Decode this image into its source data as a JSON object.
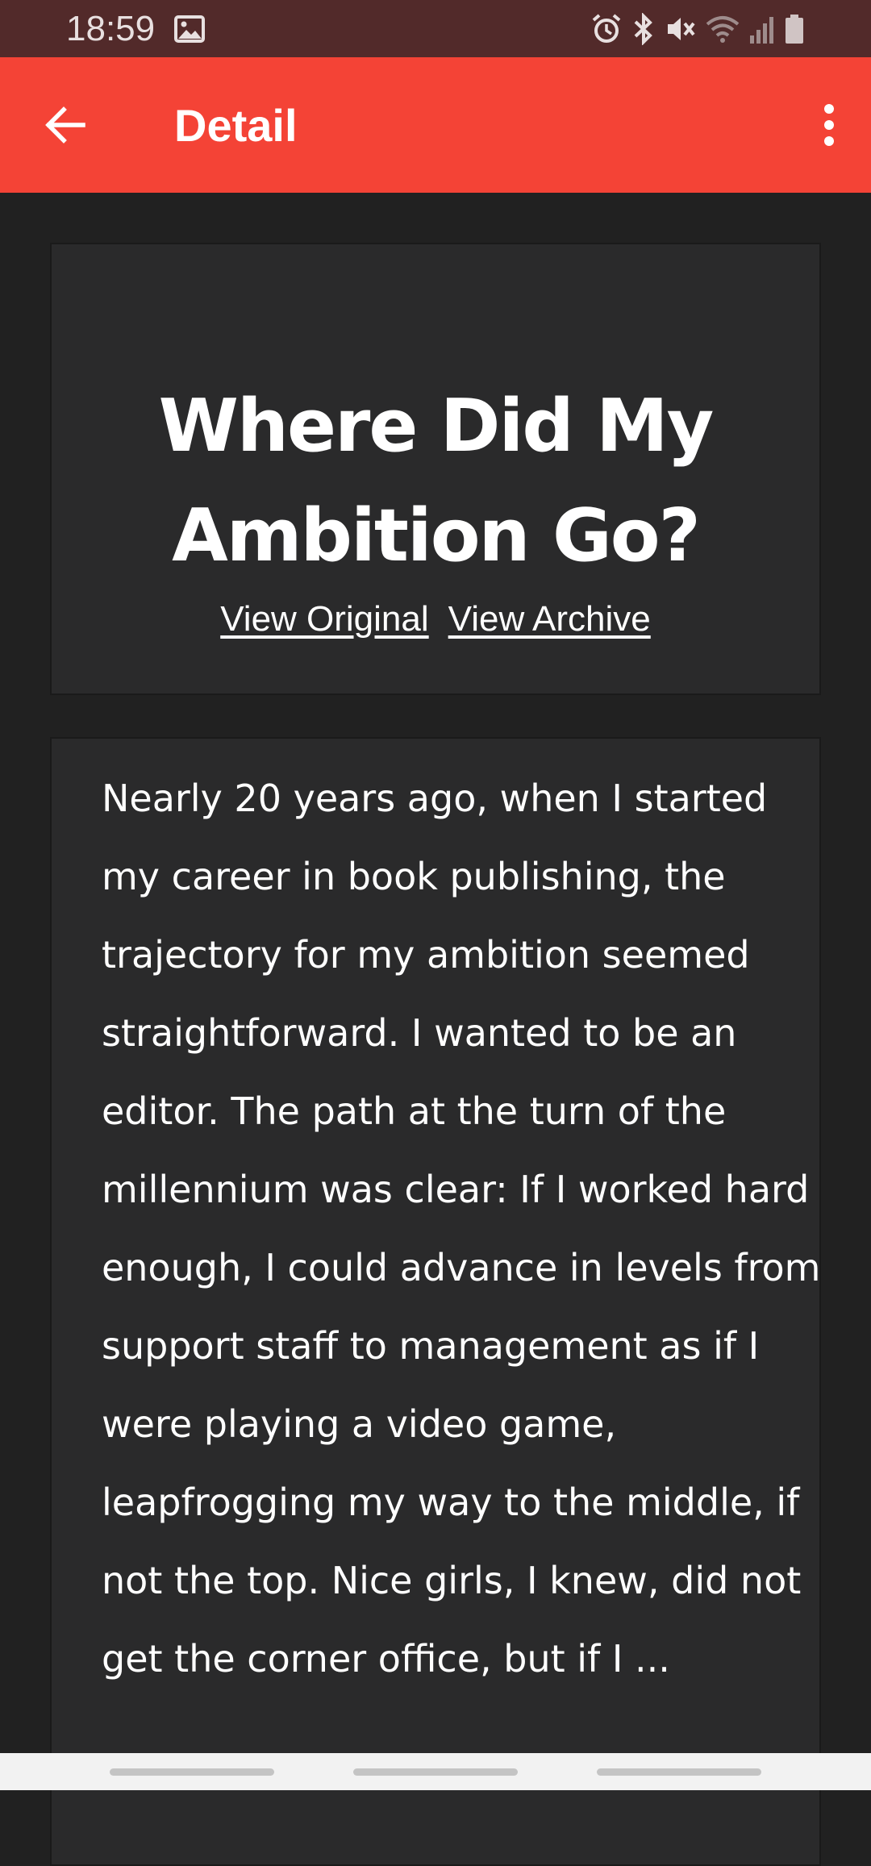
{
  "status_bar": {
    "time": "18:59",
    "icons": [
      "image-icon",
      "alarm-icon",
      "bluetooth-icon",
      "mute-icon",
      "wifi-icon",
      "signal-icon",
      "battery-icon"
    ]
  },
  "app_bar": {
    "title": "Detail",
    "back_icon": "arrow-left-icon",
    "menu_icon": "more-vert-icon",
    "color": "#f44336"
  },
  "article": {
    "title": "Where Did My Ambition Go?",
    "links": {
      "view_original": "View Original",
      "view_archive": "View Archive"
    },
    "body": "Nearly 20 years ago, when I started my career in book publishing, the trajectory for my ambition seemed straightforward. I wanted to be an editor. The path at the turn of the millennium was clear: If I worked hard enough, I could advance in levels from support staff to management as if I were playing a video game, leapfrogging my way to the middle, if not the top. Nice girls, I knew, did not get the corner office, but if I ...",
    "background": "#2a2a2b"
  },
  "nav_bar": {
    "buttons": [
      "recents",
      "home",
      "back"
    ]
  }
}
